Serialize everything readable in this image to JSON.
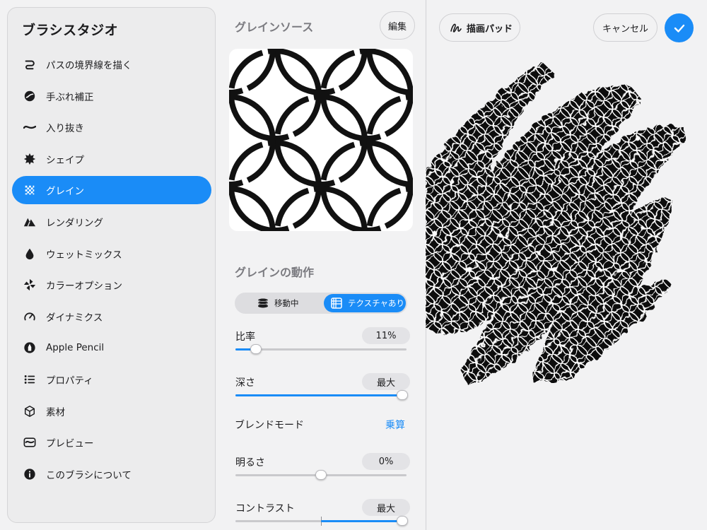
{
  "sidebar": {
    "title": "ブラシスタジオ",
    "items": [
      {
        "label": "パスの境界線を描く",
        "icon": "stroke-path-icon"
      },
      {
        "label": "手ぶれ補正",
        "icon": "stabilization-icon"
      },
      {
        "label": "入り抜き",
        "icon": "taper-icon"
      },
      {
        "label": "シェイプ",
        "icon": "shape-icon"
      },
      {
        "label": "グレイン",
        "icon": "grain-icon"
      },
      {
        "label": "レンダリング",
        "icon": "rendering-icon"
      },
      {
        "label": "ウェットミックス",
        "icon": "wet-mix-icon"
      },
      {
        "label": "カラーオプション",
        "icon": "color-options-icon"
      },
      {
        "label": "ダイナミクス",
        "icon": "dynamics-icon"
      },
      {
        "label": "Apple Pencil",
        "icon": "apple-pencil-icon"
      },
      {
        "label": "プロパティ",
        "icon": "properties-icon"
      },
      {
        "label": "素材",
        "icon": "materials-icon"
      },
      {
        "label": "プレビュー",
        "icon": "preview-icon"
      },
      {
        "label": "このブラシについて",
        "icon": "info-icon"
      }
    ],
    "active_index": 4
  },
  "grain_source": {
    "title": "グレインソース",
    "edit_label": "編集"
  },
  "grain_behavior": {
    "title": "グレインの動作",
    "mode_moving": "移動中",
    "mode_texturized": "テクスチャあり",
    "selected_mode": "テクスチャあり"
  },
  "sliders": {
    "scale": {
      "label": "比率",
      "value_text": "11%",
      "value": 0.11
    },
    "depth": {
      "label": "深さ",
      "value_text": "最大",
      "value": 1.0
    },
    "brightness": {
      "label": "明るさ",
      "value_text": "0%",
      "value": 0.0
    },
    "contrast": {
      "label": "コントラスト",
      "value_text": "最大",
      "value": 1.0
    }
  },
  "blend_mode": {
    "label": "ブレンドモード",
    "value": "乗算"
  },
  "toolbar": {
    "drawing_pad_label": "描画パッド",
    "cancel_label": "キャンセル"
  },
  "colors": {
    "accent": "#1a8cf7"
  }
}
